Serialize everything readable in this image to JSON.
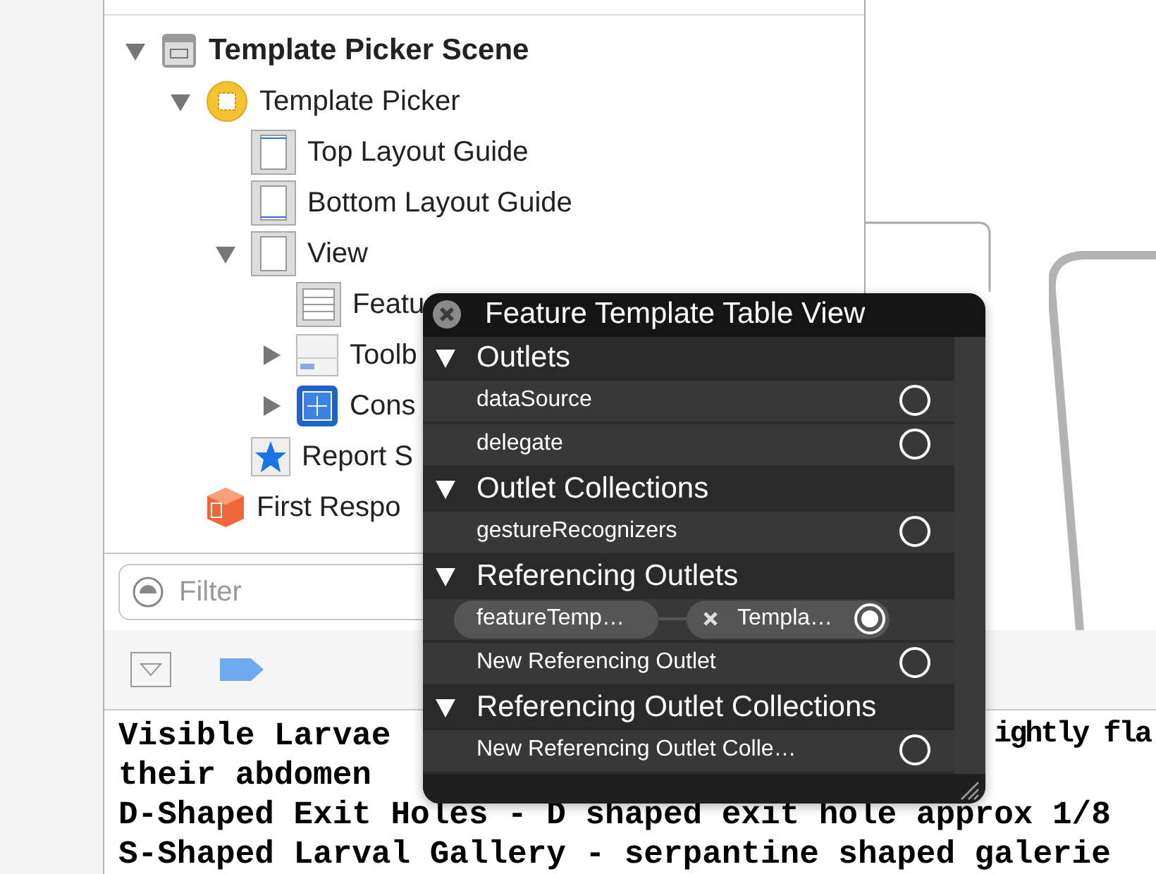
{
  "outline": {
    "items": [
      {
        "label": "Template Picker Scene",
        "kind": "scene",
        "expanded": true,
        "children": [
          {
            "label": "Template Picker",
            "kind": "controller",
            "expanded": true,
            "children": [
              {
                "label": "Top Layout Guide",
                "kind": "layout-top"
              },
              {
                "label": "Bottom Layout Guide",
                "kind": "layout-bottom"
              },
              {
                "label": "View",
                "kind": "view",
                "expanded": true,
                "children": [
                  {
                    "label": "Featu",
                    "kind": "table"
                  },
                  {
                    "label": "Toolb",
                    "kind": "toolbar",
                    "expanded": false
                  },
                  {
                    "label": "Cons",
                    "kind": "constraints",
                    "expanded": false
                  }
                ]
              },
              {
                "label": "Report S",
                "kind": "star"
              }
            ]
          },
          {
            "label": "First Respo",
            "kind": "responder"
          }
        ]
      }
    ]
  },
  "filter": {
    "placeholder": "Filter"
  },
  "console": {
    "lines": [
      {
        "left": "Visible Larvae",
        "right": "ightly fla"
      },
      {
        "left": "their abdomen"
      },
      {
        "left": "D-Shaped Exit Holes - D shaped exit hole approx 1/8"
      },
      {
        "left": "S-Shaped Larval Gallery - serpantine shaped galerie"
      }
    ]
  },
  "popup": {
    "title": "Feature Template Table View",
    "rows": [
      {
        "kind": "section",
        "label": "Outlets"
      },
      {
        "kind": "outlet",
        "label": "dataSource",
        "connected": false
      },
      {
        "kind": "outlet",
        "label": "delegate",
        "connected": false
      },
      {
        "kind": "section",
        "label": "Outlet Collections"
      },
      {
        "kind": "outlet",
        "label": "gestureRecognizers",
        "connected": false
      },
      {
        "kind": "section",
        "label": "Referencing Outlets"
      },
      {
        "kind": "connection",
        "label": "featureTemp…",
        "target": "Templa…",
        "connected": true
      },
      {
        "kind": "outlet",
        "label": "New Referencing Outlet",
        "connected": false
      },
      {
        "kind": "section",
        "label": "Referencing Outlet Collections"
      },
      {
        "kind": "outlet",
        "label": "New Referencing Outlet Colle…",
        "connected": false
      }
    ]
  }
}
